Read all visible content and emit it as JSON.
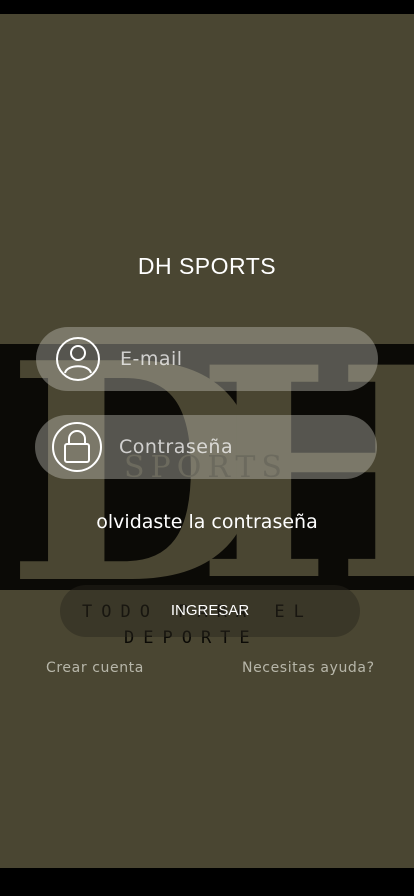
{
  "app": {
    "title": "DH SPORTS"
  },
  "background_logo": {
    "letters": [
      "D",
      "H"
    ],
    "word": "SPORTS",
    "tagline_line1": "TODO PARA EL",
    "tagline_line2": "DEPORTE"
  },
  "login_form": {
    "email": {
      "placeholder": "E-mail",
      "value": "",
      "icon": "user-icon"
    },
    "password": {
      "placeholder": "Contraseña",
      "value": "",
      "icon": "lock-icon"
    },
    "forgot_password_label": "olvidaste la contraseña",
    "submit_label": "INGRESAR"
  },
  "links": {
    "create_account": "Crear cuenta",
    "help": "Necesitas ayuda?"
  },
  "colors": {
    "background": "#4a4632",
    "text": "#ffffff",
    "field_fill": "rgba(190,190,180,0.42)"
  }
}
